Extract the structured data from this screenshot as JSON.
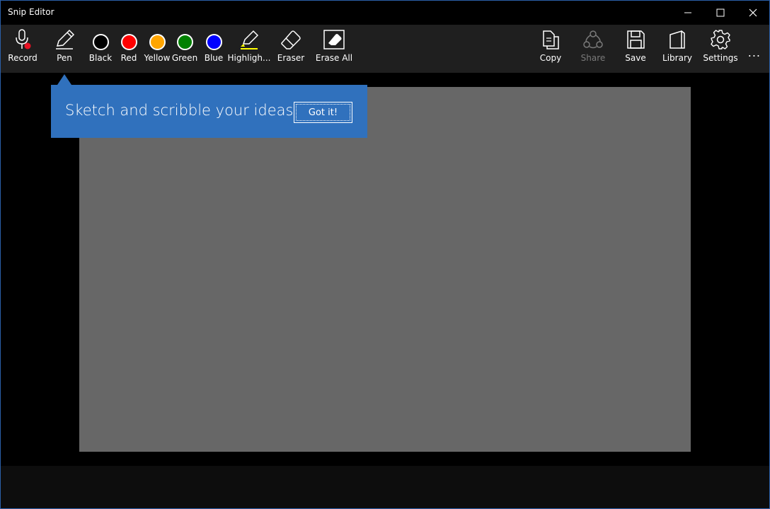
{
  "window": {
    "title": "Snip Editor",
    "controls": [
      "minimize",
      "maximize",
      "close"
    ]
  },
  "toolbar": {
    "left_tools": [
      {
        "label": "Record",
        "icon": "microphone-icon"
      },
      {
        "label": "Pen",
        "icon": "pen-icon"
      },
      {
        "label": "Black",
        "icon": "color-swatch",
        "color": "#000000"
      },
      {
        "label": "Red",
        "icon": "color-swatch",
        "color": "#ff0000"
      },
      {
        "label": "Yellow",
        "icon": "color-swatch",
        "color": "#ffa500"
      },
      {
        "label": "Green",
        "icon": "color-swatch",
        "color": "#008000"
      },
      {
        "label": "Blue",
        "icon": "color-swatch",
        "color": "#0000ff"
      },
      {
        "label": "Highligh...",
        "icon": "highlighter-icon"
      },
      {
        "label": "Eraser",
        "icon": "eraser-icon"
      },
      {
        "label": "Erase All",
        "icon": "erase-all-icon"
      }
    ],
    "right_tools": [
      {
        "label": "Copy",
        "icon": "copy-icon"
      },
      {
        "label": "Share",
        "icon": "share-icon",
        "disabled": true
      },
      {
        "label": "Save",
        "icon": "save-icon"
      },
      {
        "label": "Library",
        "icon": "library-icon"
      },
      {
        "label": "Settings",
        "icon": "gear-icon"
      }
    ],
    "more": "..."
  },
  "teaching_tip": {
    "text": "Sketch and scribble your ideas",
    "button": "Got it!"
  },
  "colors": {
    "accent": "#3071bd",
    "canvas": "#676767",
    "toolbar": "#1f1f1f"
  }
}
